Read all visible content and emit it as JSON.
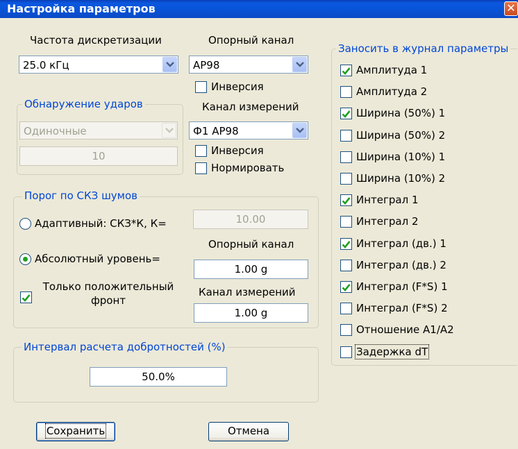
{
  "window": {
    "title": "Настройка параметров",
    "close_glyph": "✕"
  },
  "sampling": {
    "label": "Частота дискретизации",
    "value": "25.0 кГц"
  },
  "ref_channel": {
    "label": "Опорный канал",
    "value": "АР98",
    "inversion_label": "Инверсия",
    "inversion_checked": false
  },
  "meas_channel": {
    "label": "Канал измерений",
    "value": "Ф1 АР98",
    "inversion_label": "Инверсия",
    "inversion_checked": false,
    "normalize_label": "Нормировать",
    "normalize_checked": false
  },
  "hit_detection": {
    "legend": "Обнаружение ударов",
    "mode": "Одиночные",
    "count": "10"
  },
  "noise": {
    "legend": "Порог по СКЗ шумов",
    "adaptive_label": "Адаптивный: СКЗ*К, К=",
    "adaptive_value": "10.00",
    "adaptive_selected": false,
    "absolute_label": "Абсолютный уровень=",
    "absolute_selected": true,
    "ref_label": "Опорный канал",
    "ref_value": "1.00 g",
    "meas_label": "Канал измерений",
    "meas_value": "1.00 g",
    "positive_label_line1": "Только положительный",
    "positive_label_line2": "фронт",
    "positive_checked": true
  },
  "q_interval": {
    "legend": "Интервал расчета добротностей (%)",
    "value": "50.0%"
  },
  "journal": {
    "legend": "Заносить в журнал параметры",
    "items": [
      {
        "label": "Амплитуда 1",
        "checked": true
      },
      {
        "label": "Амплитуда 2",
        "checked": false
      },
      {
        "label": "Ширина (50%) 1",
        "checked": true
      },
      {
        "label": "Ширина (50%) 2",
        "checked": false
      },
      {
        "label": "Ширина (10%) 1",
        "checked": false
      },
      {
        "label": "Ширина (10%) 2",
        "checked": false
      },
      {
        "label": "Интеграл 1",
        "checked": true
      },
      {
        "label": "Интеграл 2",
        "checked": false
      },
      {
        "label": "Интеграл (дв.) 1",
        "checked": true
      },
      {
        "label": "Интеграл (дв.) 2",
        "checked": false
      },
      {
        "label": "Интеграл (F*S) 1",
        "checked": true
      },
      {
        "label": "Интеграл (F*S) 2",
        "checked": false
      },
      {
        "label": "Отношение А1/А2",
        "checked": false
      },
      {
        "label": "Задержка dT",
        "checked": false
      }
    ]
  },
  "buttons": {
    "save": "Сохранить",
    "cancel": "Отмена"
  },
  "colors": {
    "legend": "#0046d5",
    "check": "#21a121",
    "title_bar": "#0853d6"
  },
  "icons": {
    "combo_arrow": "chevron-down-icon",
    "check": "check-icon",
    "close": "close-icon"
  }
}
